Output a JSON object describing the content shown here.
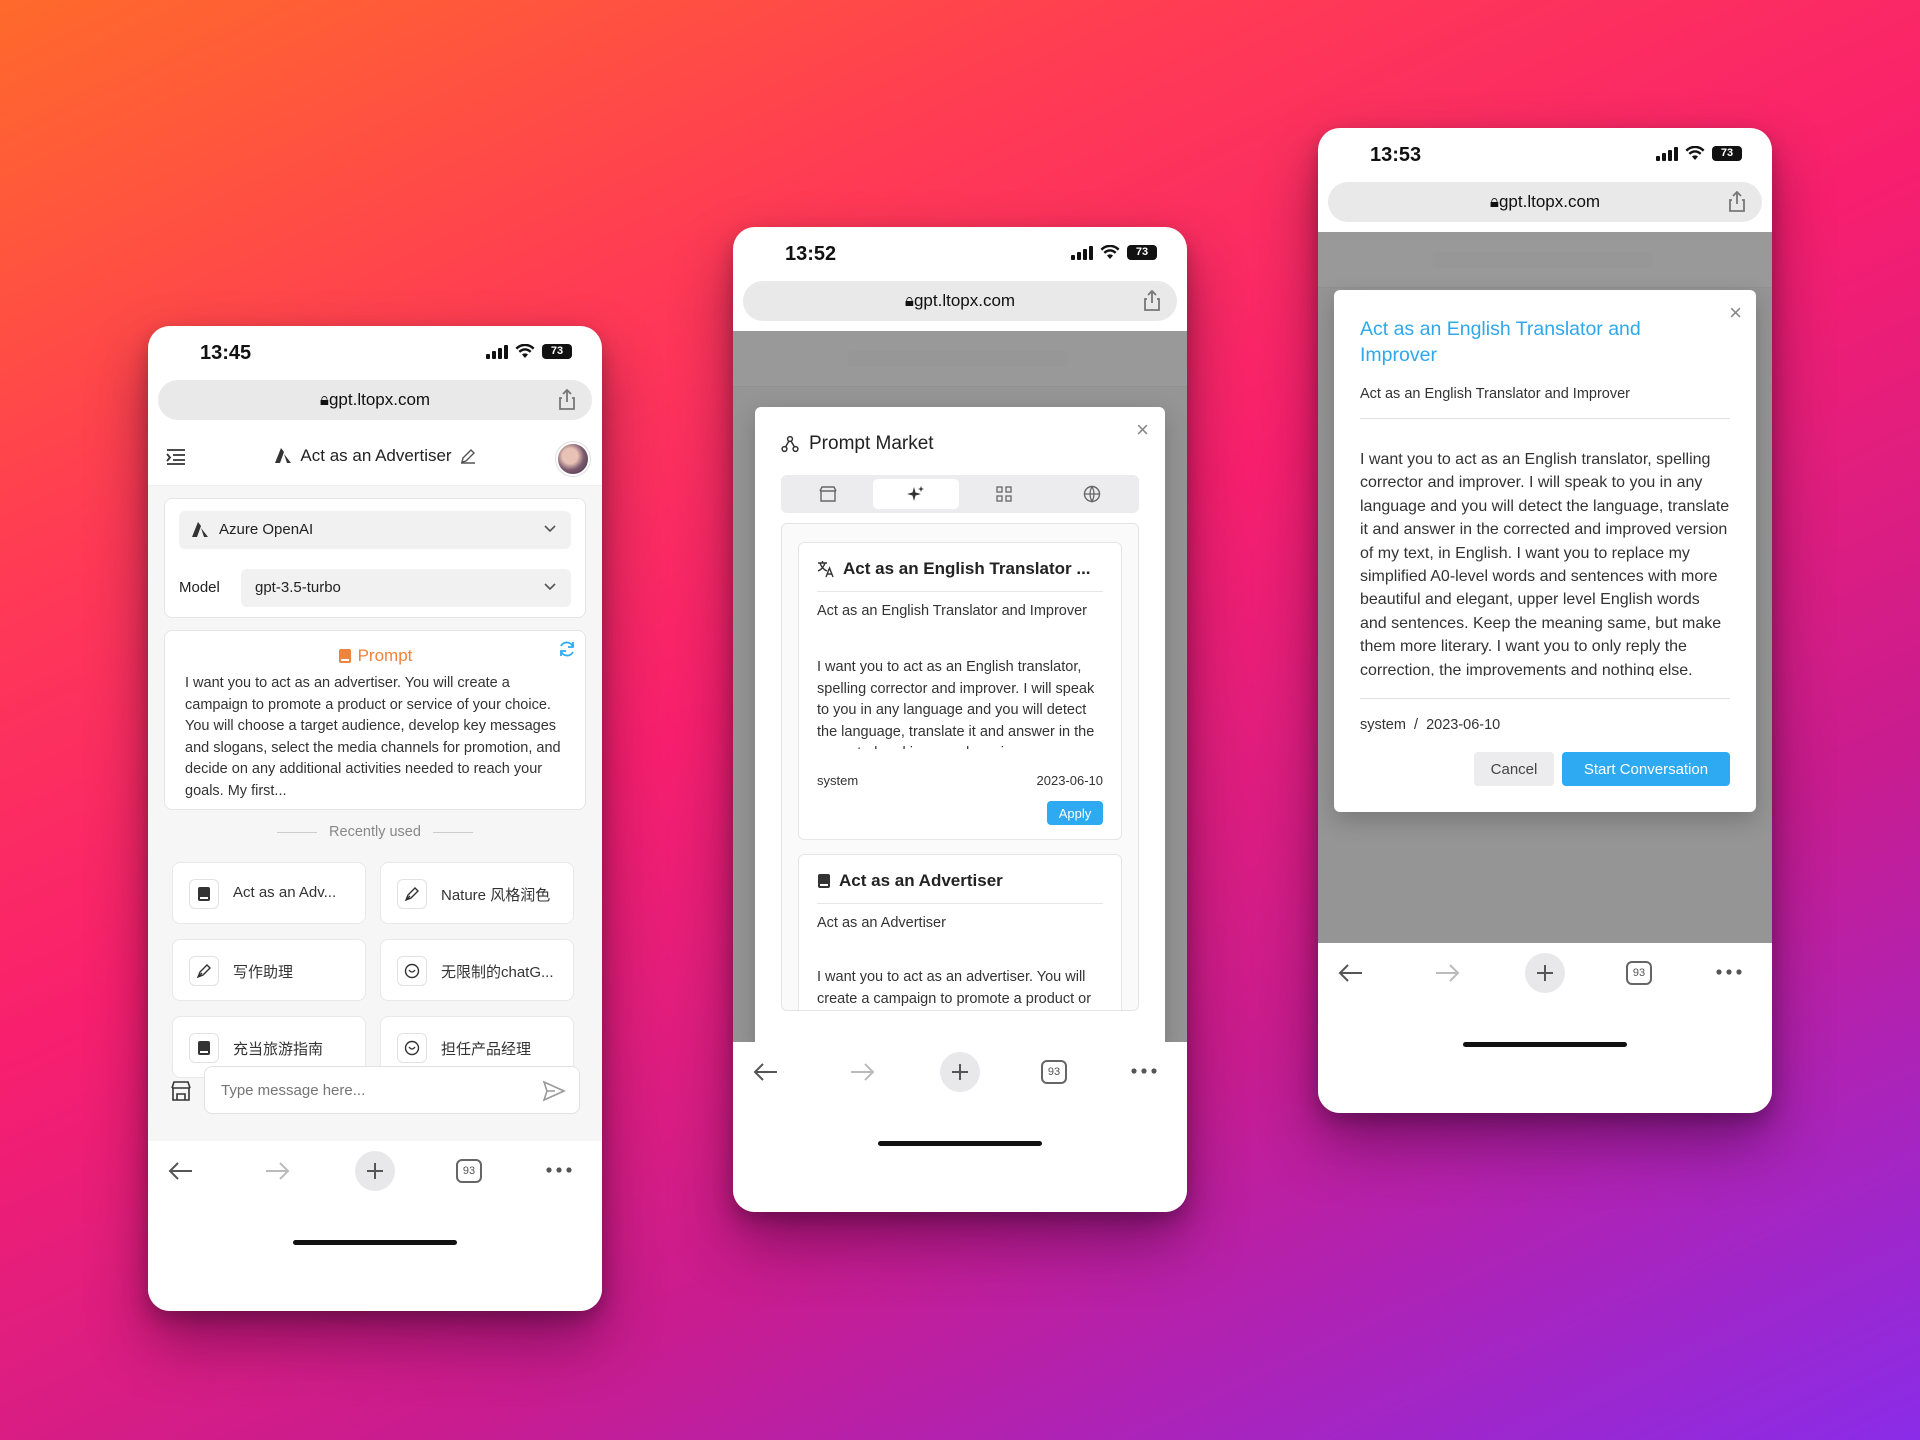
{
  "colors": {
    "accent": "#2daaf2",
    "prompt_orange": "#f0833a",
    "title_blue": "#2ea8ea"
  },
  "browser": {
    "url": "gpt.ltopx.com",
    "tabs_count": "93",
    "battery": "73"
  },
  "phone1": {
    "time": "13:45",
    "header_title": "Act as an Advertiser",
    "provider": "Azure OpenAI",
    "model_label": "Model",
    "model_value": "gpt-3.5-turbo",
    "prompt_title": "Prompt",
    "prompt_text": "I want you to act as an advertiser. You will create a campaign to promote a product or service of your choice. You will choose a target audience, develop key messages and slogans, select the media channels for promotion, and decide on any additional activities needed to reach your goals. My first...",
    "recently_used_label": "Recently used",
    "recent_items": [
      {
        "label": "Act as an Adv...",
        "icon": "book-icon"
      },
      {
        "label": "Nature 风格润色",
        "icon": "pen-icon"
      },
      {
        "label": "写作助理",
        "icon": "pen-icon"
      },
      {
        "label": "无限制的chatG...",
        "icon": "chat-icon"
      },
      {
        "label": "充当旅游指南",
        "icon": "book-icon"
      },
      {
        "label": "担任产品经理",
        "icon": "chat-icon"
      }
    ],
    "input_placeholder": "Type message here..."
  },
  "phone2": {
    "time": "13:52",
    "modal_title": "Prompt Market",
    "cards": [
      {
        "title": "Act as an English Translator ...",
        "subtitle": "Act as an English Translator and Improver",
        "body": "I want you to act as an English translator, spelling corrector and improver. I will speak to you in any language and you will detect the language, translate it and answer in the corrected and improved version",
        "author": "system",
        "date": "2023-06-10",
        "button": "Apply"
      },
      {
        "title": "Act as an Advertiser",
        "subtitle": "Act as an Advertiser",
        "body": "I want you to act as an advertiser. You will create a campaign to promote a product or service of your choice."
      }
    ]
  },
  "phone3": {
    "time": "13:53",
    "title": "Act as an English Translator and Improver",
    "subtitle": "Act as an English Translator and Improver",
    "body": "I want you to act as an English translator, spelling corrector and improver. I will speak to you in any language and you will detect the language, translate it and answer in the corrected and improved version of my text, in English. I want you to replace my simplified A0-level words and sentences with more beautiful and elegant, upper level English words and sentences. Keep the meaning same, but make them more literary. I want you to only reply the correction, the improvements and nothing else.",
    "meta": "system  /  2023-06-10",
    "cancel": "Cancel",
    "start": "Start Conversation"
  }
}
